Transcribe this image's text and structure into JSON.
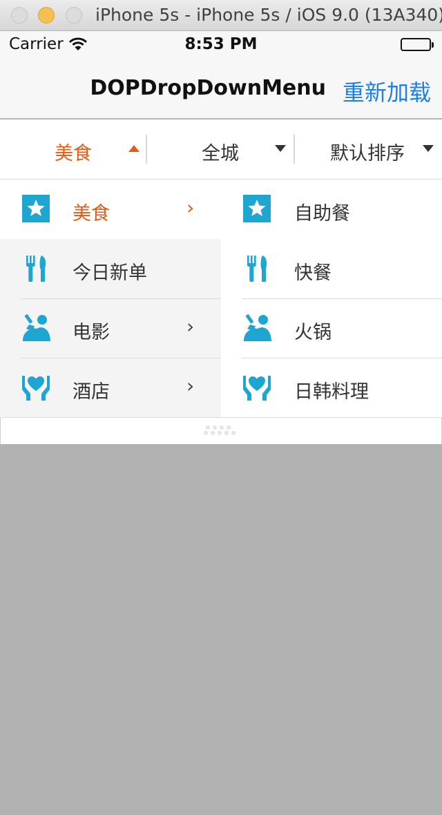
{
  "window": {
    "title": "iPhone 5s - iPhone 5s / iOS 9.0 (13A340)"
  },
  "status_bar": {
    "carrier": "Carrier",
    "time": "8:53 PM"
  },
  "nav_bar": {
    "title": "DOPDropDownMenu",
    "reload_label": "重新加载"
  },
  "tabs": [
    {
      "label": "美食",
      "active": true
    },
    {
      "label": "全城",
      "active": false
    },
    {
      "label": "默认排序",
      "active": false
    }
  ],
  "left_items": [
    {
      "label": "美食",
      "icon": "star-icon",
      "has_submenu": true,
      "selected": true
    },
    {
      "label": "今日新单",
      "icon": "fork-knife-icon",
      "has_submenu": false,
      "selected": false
    },
    {
      "label": "电影",
      "icon": "drinking-person-icon",
      "has_submenu": true,
      "selected": false
    },
    {
      "label": "酒店",
      "icon": "hands-heart-icon",
      "has_submenu": true,
      "selected": false
    }
  ],
  "right_items": [
    {
      "label": "自助餐",
      "icon": "star-icon"
    },
    {
      "label": "快餐",
      "icon": "fork-knife-icon"
    },
    {
      "label": "火锅",
      "icon": "drinking-person-icon"
    },
    {
      "label": "日韩料理",
      "icon": "hands-heart-icon"
    }
  ],
  "colors": {
    "accent_orange": "#e55b15",
    "icon_blue": "#1fa5d1",
    "link_blue": "#1e7fe6",
    "overlay_gray": "#b2b2b2"
  }
}
